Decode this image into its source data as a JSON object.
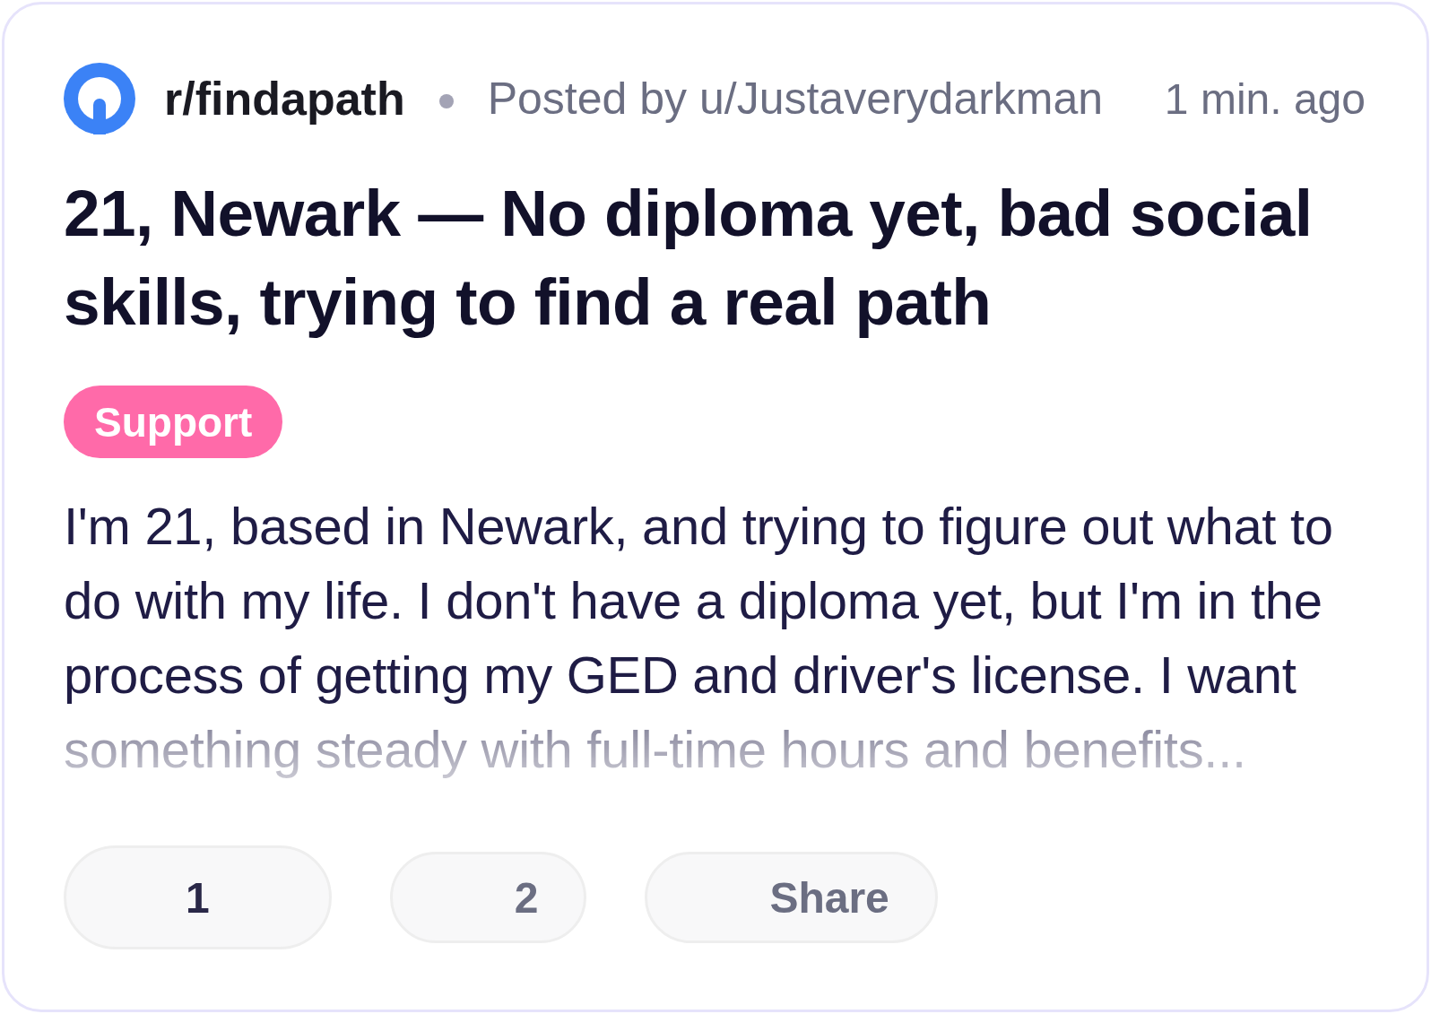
{
  "post": {
    "subreddit": "r/findapath",
    "posted_by": "Posted by u/Justaverydarkman",
    "time": "1 min. ago",
    "title": "21, Newark — No diploma yet, bad social skills, trying to find a real path",
    "flair": "Support",
    "body": {
      "text": "I'm 21, based in Newark, and trying to figure out what to do with my life. I don't have a diploma yet, but I'm in the process of getting my GED and driver's license. I want something steady with full-time hours and benefits...",
      "faded": true
    }
  },
  "actions": [
    {
      "label": "1",
      "selected": true
    },
    {
      "label": "2",
      "selected": false
    },
    {
      "label": "Share",
      "selected": false
    }
  ]
}
